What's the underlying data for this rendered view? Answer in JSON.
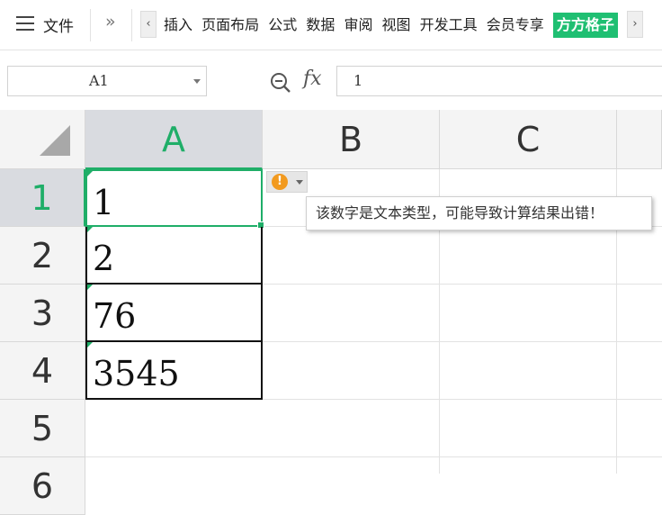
{
  "menu": {
    "file_label": "文件",
    "tabs": [
      "插入",
      "页面布局",
      "公式",
      "数据",
      "审阅",
      "视图",
      "开发工具",
      "会员专享"
    ],
    "highlight_tab": "方方格子"
  },
  "formula_bar": {
    "name_box": "A1",
    "fx_label": "fx",
    "value": "1"
  },
  "columns": [
    "A",
    "B",
    "C"
  ],
  "rows": [
    "1",
    "2",
    "3",
    "4",
    "5",
    "6"
  ],
  "cells": [
    "1",
    "2",
    "76",
    "3545"
  ],
  "warning": {
    "icon": "!",
    "message": "该数字是文本类型，可能导致计算结果出错！"
  },
  "colors": {
    "accent_green": "#1fae68",
    "tab_highlight": "#1fbf72",
    "warning_orange": "#f29a1f"
  }
}
